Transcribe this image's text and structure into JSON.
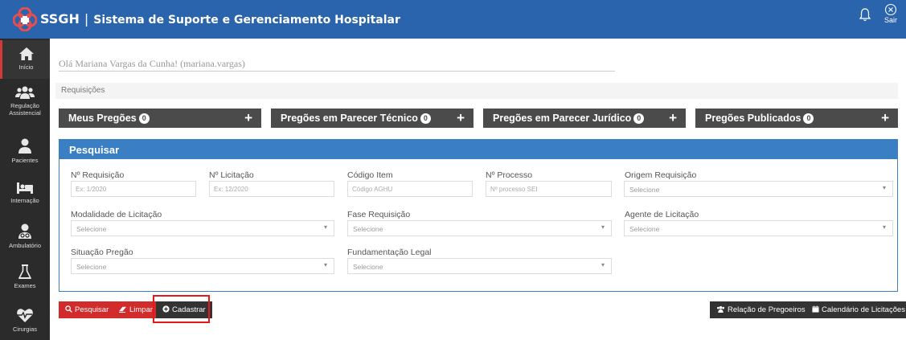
{
  "app": {
    "brand_short": "SSGH",
    "separator": "|",
    "brand_full": "Sistema de Suporte e Gerenciamento Hospitalar",
    "exit_label": "Sair"
  },
  "sidebar": {
    "items": [
      {
        "label": "Início",
        "icon": "home-icon"
      },
      {
        "label": "Regulação Assistencial",
        "icon": "users-icon"
      },
      {
        "label": "Pacientes",
        "icon": "user-icon"
      },
      {
        "label": "Internação",
        "icon": "bed-icon"
      },
      {
        "label": "Ambulatório",
        "icon": "doctor-icon"
      },
      {
        "label": "Exames",
        "icon": "flask-icon"
      },
      {
        "label": "Cirurgias",
        "icon": "heartbeat-icon"
      }
    ]
  },
  "greeting": "Olá Mariana Vargas da Cunha! (mariana.vargas)",
  "breadcrumb": "Requisições",
  "tabs": [
    {
      "label": "Meus Pregões",
      "count": "0"
    },
    {
      "label": "Pregões em Parecer Técnico",
      "count": "0"
    },
    {
      "label": "Pregões em Parecer Jurídico",
      "count": "0"
    },
    {
      "label": "Pregões Publicados",
      "count": "0"
    }
  ],
  "search": {
    "title": "Pesquisar",
    "fields": {
      "requisicao": {
        "label": "Nº Requisição",
        "placeholder": "Ex: 1/2020"
      },
      "licitacao": {
        "label": "Nº Licitação",
        "placeholder": "Ex: 12/2020"
      },
      "codigo_item": {
        "label": "Código Item",
        "placeholder": "Código AGHU"
      },
      "processo": {
        "label": "Nº Processo",
        "placeholder": "Nº processo SEI"
      },
      "origem": {
        "label": "Origem Requisição",
        "value": "Selecione"
      },
      "modalidade": {
        "label": "Modalidade de Licitação",
        "value": "Selecione"
      },
      "fase": {
        "label": "Fase Requisição",
        "value": "Selecione"
      },
      "agente": {
        "label": "Agente de Licitação",
        "value": "Selecione"
      },
      "situacao": {
        "label": "Situação Pregão",
        "value": "Selecione"
      },
      "fundamentacao": {
        "label": "Fundamentação Legal",
        "value": "Selecione"
      }
    }
  },
  "actions": {
    "pesquisar": "Pesquisar",
    "limpar": "Limpar",
    "cadastrar": "Cadastrar",
    "relacao": "Relação de Pregoeiros",
    "calendario": "Calendário de Licitações"
  },
  "colors": {
    "topbar": "#2a64ad",
    "sidebar": "#2b2b2b",
    "tab": "#4b4b4b",
    "panel": "#3a7fc4",
    "danger": "#d22b2b",
    "highlight": "#e51919"
  }
}
